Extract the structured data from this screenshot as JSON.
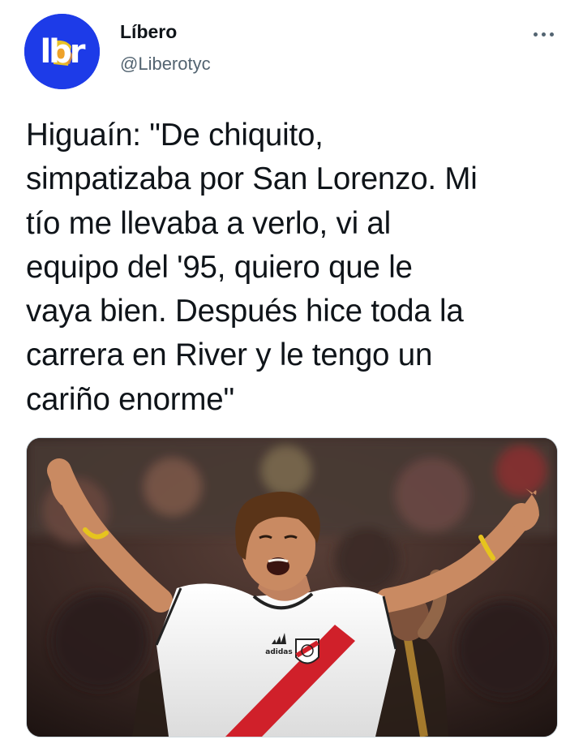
{
  "author": {
    "name": "Líbero",
    "handle": "@Liberotyc",
    "avatar_text": "lbr",
    "avatar_color": "#1d3be8"
  },
  "more_icon": "more-horizontal-icon",
  "tweet": {
    "text": "Higuaín: \"De chiquito,\nsimpatizaba por San Lorenzo. Mi\ntío me llevaba a verlo, vi al\nequipo del '95, quiero que le\nvaya bien. Después hice toda la\ncarrera en River y le tengo un\ncariño enorme\""
  },
  "media": {
    "jersey_brand": "adidas",
    "badge_text": "RP",
    "colors": {
      "jersey": "#f4f4f2",
      "sash": "#d0202a",
      "hair": "#5a3418",
      "skin": "#c98a62"
    }
  }
}
